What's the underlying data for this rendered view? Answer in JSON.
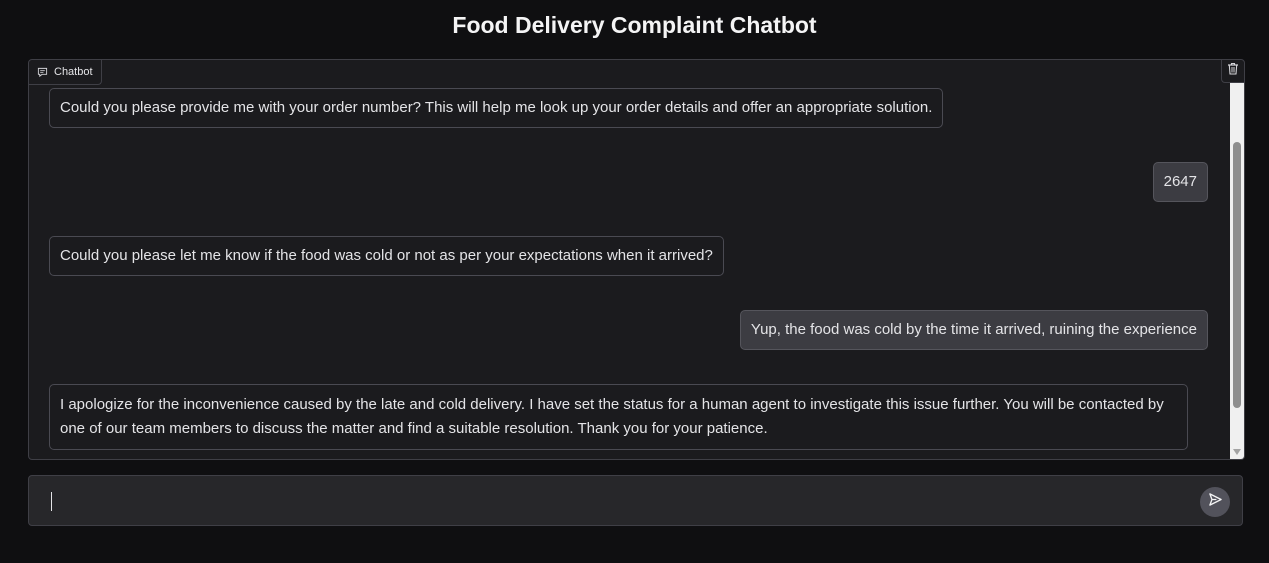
{
  "header": {
    "title": "Food Delivery Complaint Chatbot"
  },
  "chatbot": {
    "label": "Chatbot",
    "label_icon": "chat-bubble-icon",
    "clear_icon": "trash-icon",
    "messages": [
      {
        "role": "bot",
        "text": "Could you please provide me with your order number? This will help me look up your order details and offer an appropriate solution."
      },
      {
        "role": "user",
        "text": "2647"
      },
      {
        "role": "bot",
        "text": "Could you please let me know if the food was cold or not as per your expectations when it arrived?"
      },
      {
        "role": "user",
        "text": "Yup, the food was cold by the time it arrived, ruining the experience"
      },
      {
        "role": "bot",
        "text": "I apologize for the inconvenience caused by the late and cold delivery. I have set the status for a human agent to investigate this issue further. You will be contacted by one of our team members to discuss the matter and find a suitable resolution. Thank you for your patience."
      }
    ]
  },
  "input": {
    "value": "",
    "placeholder": "",
    "send_icon": "send-icon"
  },
  "colors": {
    "background": "#0f0f11",
    "panel": "#1b1b1e",
    "user_bubble": "#3c3c42",
    "border": "#3f3f46"
  }
}
